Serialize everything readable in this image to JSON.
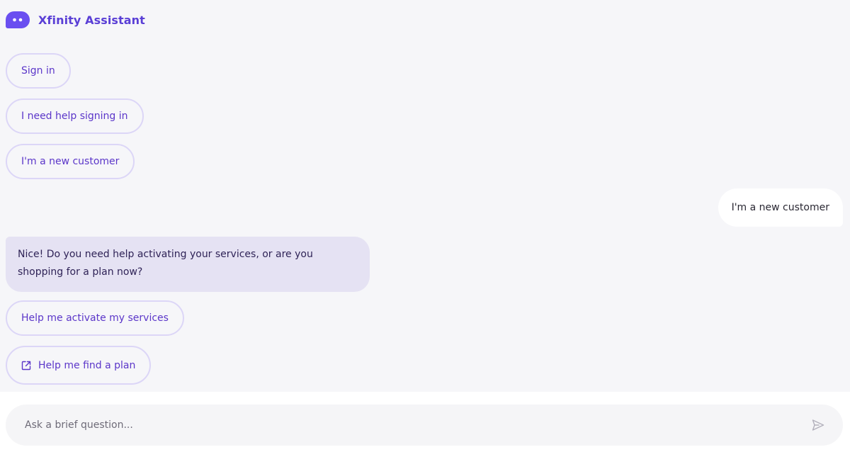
{
  "header": {
    "title": "Xfinity Assistant",
    "logo_icon": "chat-bubble-icon",
    "accent_color": "#5a3fd6"
  },
  "quick_replies_initial": [
    {
      "label": "Sign in"
    },
    {
      "label": "I need help signing in"
    },
    {
      "label": "I'm a new customer"
    }
  ],
  "messages": [
    {
      "sender": "user",
      "text": "I'm a new customer"
    },
    {
      "sender": "assistant",
      "text": "Nice! Do you need help activating your services, or are you shopping for a plan now?"
    }
  ],
  "quick_replies_followup": [
    {
      "label": "Help me activate my services"
    },
    {
      "label": "Help me find a plan",
      "icon": "external-link-icon"
    }
  ],
  "composer": {
    "placeholder": "Ask a brief question...",
    "value": "",
    "send_icon": "send-icon"
  }
}
